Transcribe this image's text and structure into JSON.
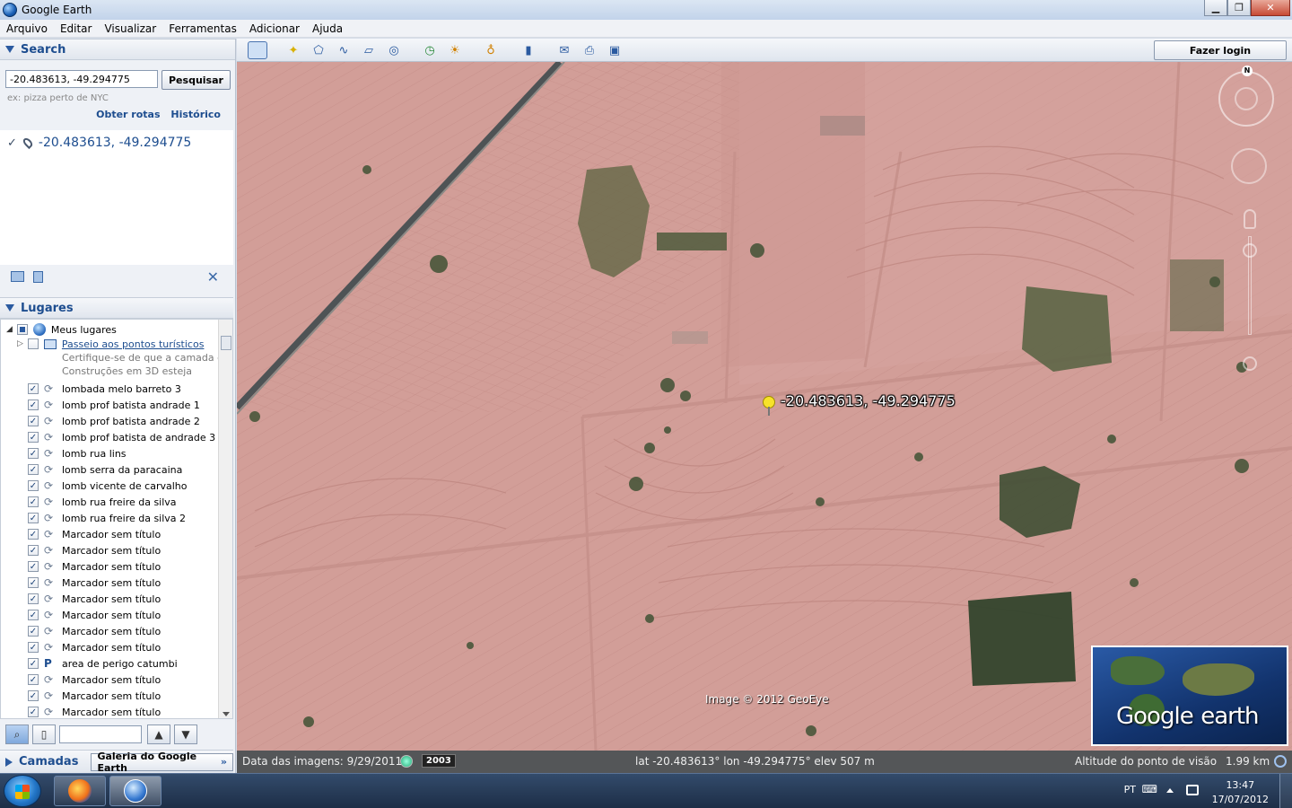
{
  "window": {
    "title": "Google Earth"
  },
  "menu": [
    "Arquivo",
    "Editar",
    "Visualizar",
    "Ferramentas",
    "Adicionar",
    "Ajuda"
  ],
  "search": {
    "header": "Search",
    "value": "-20.483613, -49.294775",
    "button": "Pesquisar",
    "hint": "ex: pizza perto de NYC",
    "link_routes": "Obter rotas",
    "link_history": "Histórico",
    "result": "-20.483613, -49.294775"
  },
  "places": {
    "header": "Lugares",
    "root": "Meus lugares",
    "tour_link": "Passeio aos pontos turísticos",
    "tour_note_1": "Certifique-se de que a camada de",
    "tour_note_2": "Construções em 3D esteja",
    "items": [
      "lombada melo barreto 3",
      "lomb prof batista andrade 1",
      "lomb prof batista andrade 2",
      "lomb prof batista de andrade 3",
      "lomb rua lins",
      "lomb serra da paracaina",
      "lomb vicente de carvalho",
      "lomb rua freire da silva",
      "lomb rua freire da silva 2",
      "Marcador sem título",
      "Marcador sem título",
      "Marcador sem título",
      "Marcador sem título",
      "Marcador sem título",
      "Marcador sem título",
      "Marcador sem título",
      "Marcador sem título",
      "area de perigo catumbi",
      "Marcador sem título",
      "Marcador sem título",
      "Marcador sem título"
    ]
  },
  "layers": {
    "header": "Camadas",
    "gallery": "Galeria do Google Earth"
  },
  "toolbar": {
    "login": "Fazer login"
  },
  "map": {
    "placemark_label": "-20.483613, -49.294775",
    "copyright": "Image © 2012 GeoEye",
    "compass_n": "N",
    "logo_google": "Google",
    "logo_earth": "earth"
  },
  "status": {
    "imagery_date": "Data das imagens: 9/29/2011",
    "year": "2003",
    "coords": "lat  -20.483613°  lon  -49.294775°  elev   507 m",
    "eye_alt_label": "Altitude do ponto de visão",
    "eye_alt_value": "1.99 km"
  },
  "taskbar": {
    "lang": "PT",
    "time": "13:47",
    "date": "17/07/2012"
  }
}
